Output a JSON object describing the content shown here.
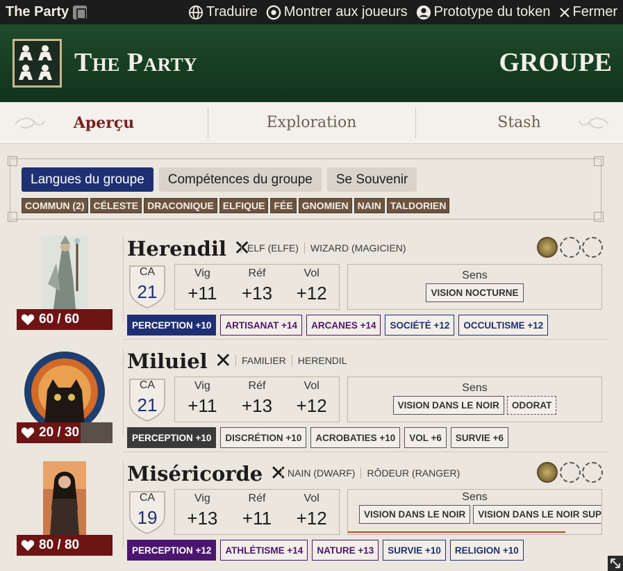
{
  "window": {
    "title": "The Party",
    "actions": [
      {
        "label": "Traduire",
        "icon": "globe-icon"
      },
      {
        "label": "Montrer aux joueurs",
        "icon": "eye-icon"
      },
      {
        "label": "Prototype du token",
        "icon": "user-circle-icon"
      },
      {
        "label": "Fermer",
        "icon": "close-icon"
      }
    ]
  },
  "banner": {
    "title": "The Party",
    "kind": "GROUPE"
  },
  "tabs": [
    "Aperçu",
    "Exploration",
    "Stash"
  ],
  "group_tabs": [
    "Langues du groupe",
    "Compétences du groupe",
    "Se Souvenir"
  ],
  "languages": [
    "COMMUN (2)",
    "CÉLESTE",
    "DRACONIQUE",
    "ELFIQUE",
    "FÉE",
    "GNOMIEN",
    "NAIN",
    "TALDORIEN"
  ],
  "members": [
    {
      "name": "Herendil",
      "traits": [
        "ELF (ELFE)",
        "WIZARD (MAGICIEN)"
      ],
      "hp": "60 / 60",
      "hp_fraction": 1.0,
      "ac_label": "CA",
      "ac": "21",
      "saves": [
        {
          "label": "Vig",
          "value": "+11"
        },
        {
          "label": "Réf",
          "value": "+13"
        },
        {
          "label": "Vol",
          "value": "+12"
        }
      ],
      "senses_title": "Sens",
      "senses": [
        "VISION NOCTURNE"
      ],
      "skills": [
        "PERCEPTION +10",
        "ARTISANAT +14",
        "ARCANES +14",
        "SOCIÉTÉ +12",
        "OCCULTISME +12"
      ],
      "hero_points": 1
    },
    {
      "name": "Miluiel",
      "traits": [
        "FAMILIER",
        "HERENDIL"
      ],
      "hp": "20 / 30",
      "hp_fraction": 0.667,
      "ac_label": "CA",
      "ac": "21",
      "saves": [
        {
          "label": "Vig",
          "value": "+11"
        },
        {
          "label": "Réf",
          "value": "+13"
        },
        {
          "label": "Vol",
          "value": "+12"
        }
      ],
      "senses_title": "Sens",
      "senses": [
        "VISION DANS LE NOIR",
        "ODORAT"
      ],
      "skills": [
        "PERCEPTION +10",
        "DISCRÉTION +10",
        "ACROBATIES +10",
        "VOL +6",
        "SURVIE +6"
      ]
    },
    {
      "name": "Miséricorde",
      "traits": [
        "NAIN (DWARF)",
        "RÔDEUR (RANGER)"
      ],
      "hp": "80 / 80",
      "hp_fraction": 1.0,
      "ac_label": "CA",
      "ac": "19",
      "saves": [
        {
          "label": "Vig",
          "value": "+13"
        },
        {
          "label": "Réf",
          "value": "+11"
        },
        {
          "label": "Vol",
          "value": "+12"
        }
      ],
      "senses_title": "Sens",
      "senses": [
        "VISION DANS LE NOIR",
        "VISION DANS LE NOIR SUPÉR"
      ],
      "skills": [
        "PERCEPTION +12",
        "ATHLÉTISME +14",
        "NATURE +13",
        "SURVIE +10",
        "RELIGION +10"
      ],
      "hero_points": 1
    }
  ],
  "colors": {
    "banner": "#1f4a2c",
    "tab_active": "#7a1f1f",
    "group_tab_active": "#1f2f73",
    "hp_bar": "#6d1414",
    "lang_tag": "#6b5440",
    "skill_herendil": "#4b1670",
    "skill_miluiel": "#3a3a3a",
    "skill_misericorde": "#4b1670"
  }
}
